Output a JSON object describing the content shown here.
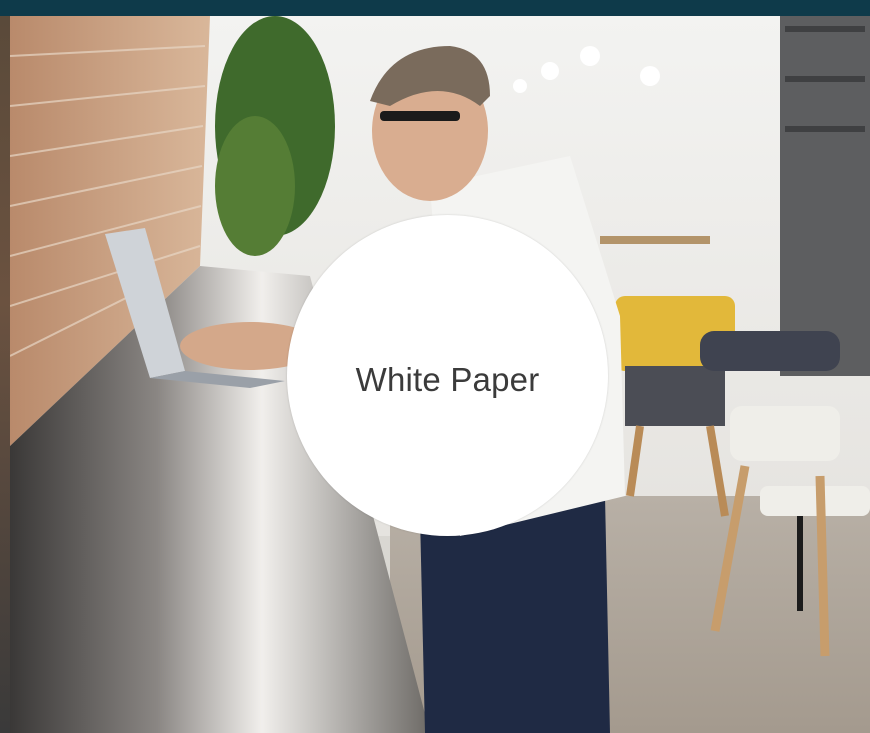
{
  "card": {
    "badge_label": "White Paper",
    "photo_description": "",
    "colors": {
      "frame": "#0e3b47",
      "badge_background": "#ffffff",
      "badge_text": "#3b3b3b"
    }
  }
}
